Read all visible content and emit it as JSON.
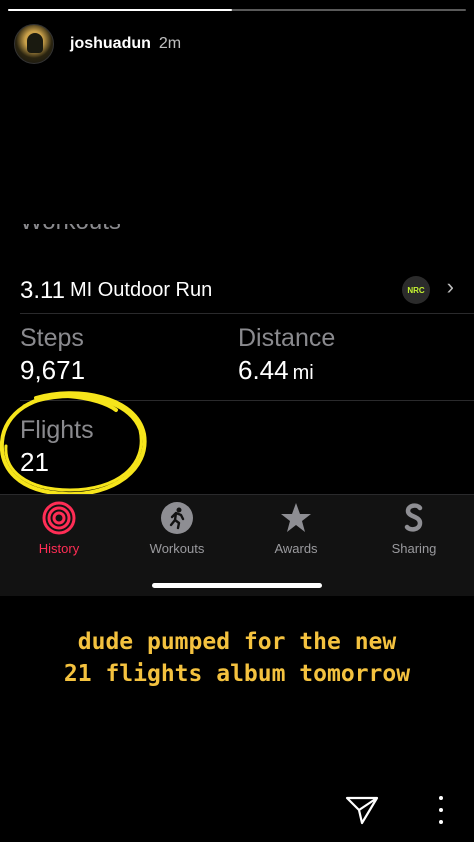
{
  "story": {
    "progress": 0.49,
    "username": "joshuadun",
    "time": "2m"
  },
  "activity": {
    "section_title": "Workouts",
    "workout": {
      "distance_num": "3.11",
      "label": "MI Outdoor Run",
      "badge": "NRC",
      "chevron": "›"
    },
    "steps_label": "Steps",
    "steps_value": "9,671",
    "distance_label": "Distance",
    "distance_value": "6.44",
    "distance_unit": "mi",
    "flights_label": "Flights",
    "flights_value": "21"
  },
  "tabs": [
    {
      "label": "History",
      "icon": "activity-rings-icon",
      "active": true
    },
    {
      "label": "Workouts",
      "icon": "running-figure-icon",
      "active": false
    },
    {
      "label": "Awards",
      "icon": "star-award-icon",
      "active": false
    },
    {
      "label": "Sharing",
      "icon": "sharing-s-icon",
      "active": false
    }
  ],
  "caption": "dude pumped for the new\n21 flights album tomorrow",
  "colors": {
    "accent_active": "#ff2d55",
    "annotation_yellow": "#f6e51b",
    "caption_yellow": "#f4c23f",
    "nrc_green": "#c6f432"
  },
  "actions": {
    "send_icon": "send-icon",
    "more_icon": "more-options-icon"
  }
}
